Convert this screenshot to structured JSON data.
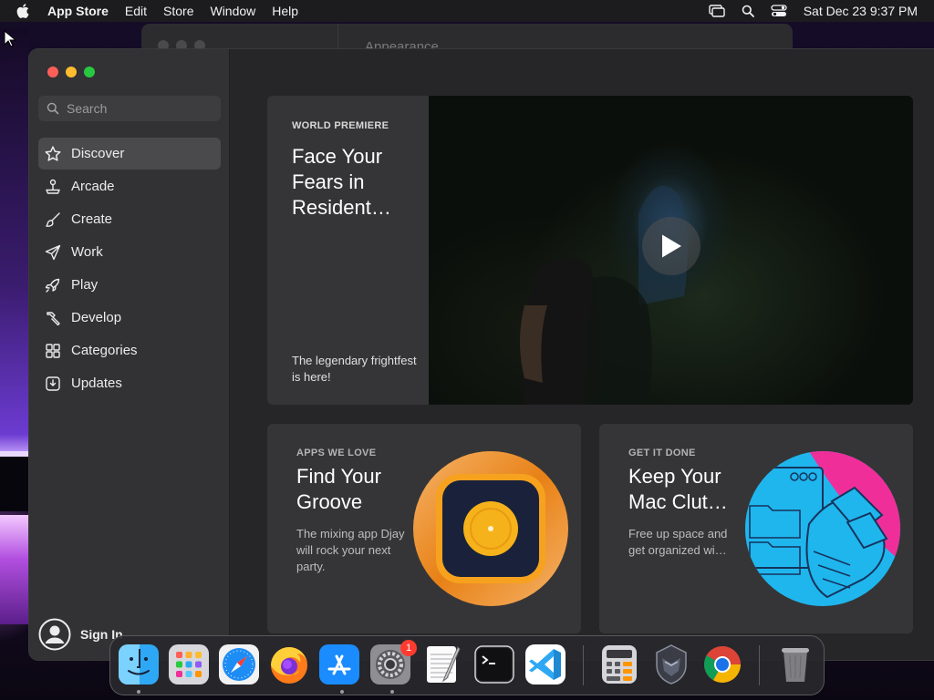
{
  "menubar": {
    "app_name": "App Store",
    "items": [
      "Edit",
      "Store",
      "Window",
      "Help"
    ],
    "clock": "Sat Dec 23  9:37 PM"
  },
  "background_window": {
    "title": "Appearance"
  },
  "sidebar": {
    "search_placeholder": "Search",
    "items": [
      {
        "label": "Discover",
        "icon": "star-icon",
        "active": true
      },
      {
        "label": "Arcade",
        "icon": "joystick-icon"
      },
      {
        "label": "Create",
        "icon": "brush-icon"
      },
      {
        "label": "Work",
        "icon": "paper-plane-icon"
      },
      {
        "label": "Play",
        "icon": "rocket-icon"
      },
      {
        "label": "Develop",
        "icon": "hammer-icon"
      },
      {
        "label": "Categories",
        "icon": "grid-icon"
      },
      {
        "label": "Updates",
        "icon": "updates-icon"
      }
    ],
    "signin_label": "Sign In"
  },
  "hero": {
    "eyebrow": "WORLD PREMIERE",
    "title": "Face Your Fears in Resident…",
    "subtitle": "The legendary frightfest is here!"
  },
  "cards": [
    {
      "eyebrow": "APPS WE LOVE",
      "title": "Find Your Groove",
      "description": "The mixing app Djay will rock your next party.",
      "art": "djay-icon"
    },
    {
      "eyebrow": "GET IT DONE",
      "title": "Keep Your Mac Clut…",
      "description": "Free up space and get organized wi…",
      "art": "folders-illustration"
    }
  ],
  "dock": {
    "apps": [
      "finder",
      "launchpad",
      "safari",
      "firefox",
      "app-store",
      "system-settings",
      "textedit",
      "terminal",
      "vscode",
      "calculator",
      "warp",
      "chrome",
      "trash"
    ],
    "settings_badge": "1"
  },
  "colors": {
    "accent_red": "#ff5f57",
    "accent_yellow": "#febc2e",
    "accent_green": "#28c840",
    "djay_orange": "#f7941d",
    "cleaner_pink": "#f02e9a",
    "cleaner_cyan": "#1fb6ee"
  }
}
